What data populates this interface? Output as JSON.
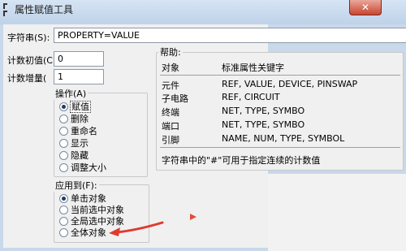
{
  "window": {
    "title": "属性赋值工具",
    "close_glyph": "✕"
  },
  "form": {
    "string_label": "字符串(S):",
    "string_value": "PROPERTY=VALUE",
    "count_init_label": "计数初值(C",
    "count_init_value": "0",
    "count_inc_label": "计数增量(",
    "count_inc_value": "1"
  },
  "operation": {
    "title": "操作(A)",
    "options": [
      {
        "label": "赋值",
        "checked": true
      },
      {
        "label": "删除",
        "checked": false
      },
      {
        "label": "重命名",
        "checked": false
      },
      {
        "label": "显示",
        "checked": false
      },
      {
        "label": "隐藏",
        "checked": false
      },
      {
        "label": "调整大小",
        "checked": false
      }
    ]
  },
  "apply_to": {
    "title": "应用到(F):",
    "options": [
      {
        "label": "单击对象",
        "checked": true
      },
      {
        "label": "当前选中对象",
        "checked": false
      },
      {
        "label": "全局选中对象",
        "checked": false
      },
      {
        "label": "全体对象",
        "checked": false
      }
    ]
  },
  "help": {
    "title": "帮助:",
    "col_object": "对象",
    "col_keyword": "标准属性关键字",
    "rows": [
      {
        "object": "元件",
        "keyword": "REF, VALUE, DEVICE, PINSWAP"
      },
      {
        "object": "子电路",
        "keyword": "REF, CIRCUIT"
      },
      {
        "object": "终端",
        "keyword": "NET, TYPE, SYMBO"
      },
      {
        "object": "端口",
        "keyword": "NET, TYPE, SYMBO"
      },
      {
        "object": "引脚",
        "keyword": "NAME, NUM, TYPE, SYMBOL"
      }
    ],
    "note": "字符串中的\"#\"可用于指定连续的计数值"
  },
  "colors": {
    "annotation_arrow": "#e03a2f"
  }
}
